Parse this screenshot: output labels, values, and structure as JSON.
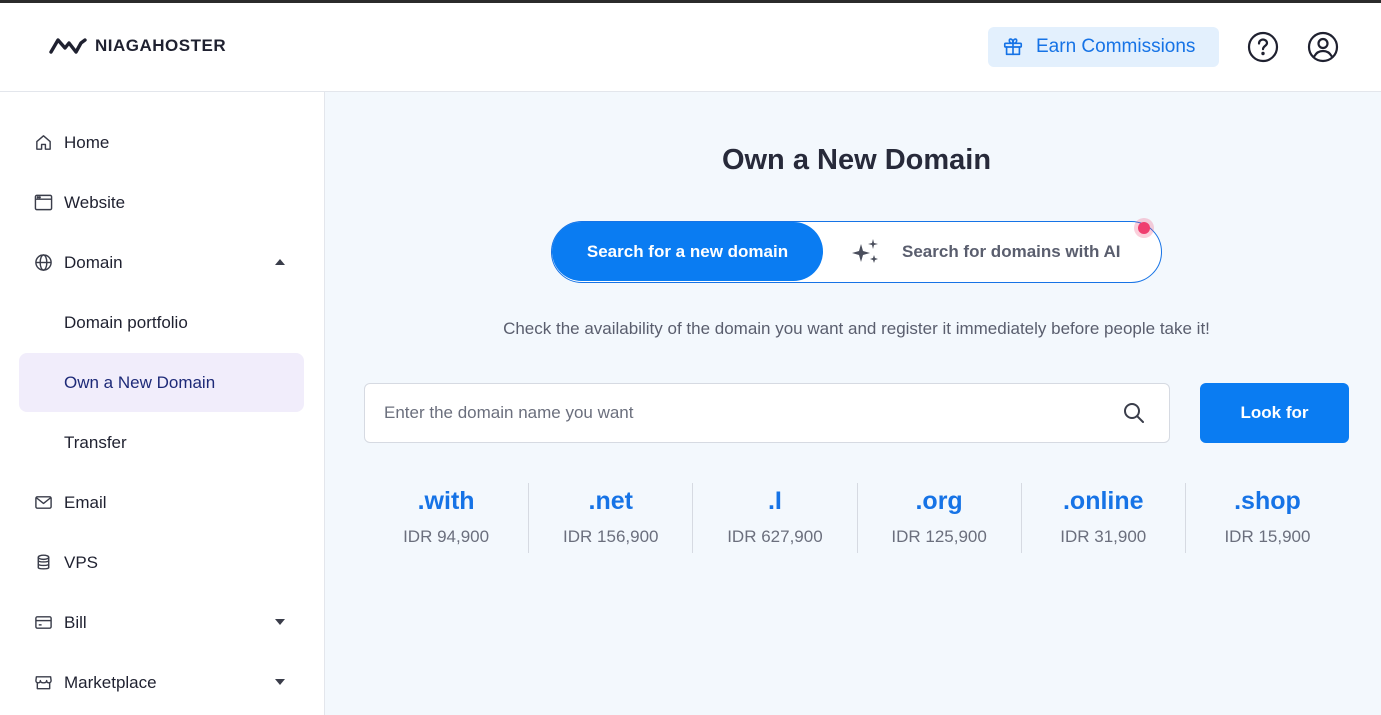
{
  "header": {
    "brand": "NIAGAHOSTER",
    "earn_label": "Earn Commissions",
    "colors": {
      "accent": "#1673e6",
      "earn_bg": "#e3f0fd"
    }
  },
  "sidebar": {
    "items": [
      {
        "label": "Home",
        "icon": "home-icon"
      },
      {
        "label": "Website",
        "icon": "browser-window-icon"
      },
      {
        "label": "Domain",
        "icon": "globe-icon",
        "expanded": true
      },
      {
        "label": "Domain portfolio"
      },
      {
        "label": "Own a New Domain",
        "active": true
      },
      {
        "label": "Transfer"
      },
      {
        "label": "Email",
        "icon": "mail-icon"
      },
      {
        "label": "VPS",
        "icon": "database-icon"
      },
      {
        "label": "Bill",
        "icon": "credit-card-icon",
        "expanded": false
      },
      {
        "label": "Marketplace",
        "icon": "store-icon",
        "expanded": false
      }
    ]
  },
  "main": {
    "title": "Own a New Domain",
    "toggle": {
      "active_label": "Search for a new domain",
      "ai_label": "Search for domains with AI"
    },
    "subtitle": "Check the availability of the domain you want and register it immediately before people take it!",
    "search": {
      "placeholder": "Enter the domain name you want",
      "value": "",
      "button_label": "Look for"
    },
    "tlds": [
      {
        "name": ".with",
        "price": "IDR 94,900"
      },
      {
        "name": ".net",
        "price": "IDR 156,900"
      },
      {
        "name": ".I",
        "price": "IDR 627,900"
      },
      {
        "name": ".org",
        "price": "IDR 125,900"
      },
      {
        "name": ".online",
        "price": "IDR 31,900"
      },
      {
        "name": ".shop",
        "price": "IDR 15,900"
      }
    ]
  }
}
